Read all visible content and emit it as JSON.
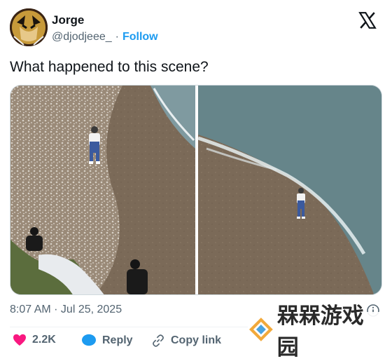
{
  "author": {
    "name": "Jorge",
    "handle": "@djodjeee_",
    "separator": "·",
    "follow_label": "Follow"
  },
  "tweet": {
    "text": "What happened to this scene?"
  },
  "timestamp": "8:07 AM · Jul 25, 2025",
  "actions": {
    "likes_count": "2.2K",
    "reply_label": "Reply",
    "copy_link_label": "Copy link"
  },
  "watermark": {
    "text": "槑槑游戏园"
  },
  "icons": {
    "brand": "x-logo-icon",
    "info": "info-icon",
    "like": "heart-icon",
    "reply": "reply-bubble-icon",
    "copy": "link-icon"
  },
  "colors": {
    "accent": "#1d9bf0",
    "like": "#f91880",
    "secondary_text": "#536471"
  }
}
